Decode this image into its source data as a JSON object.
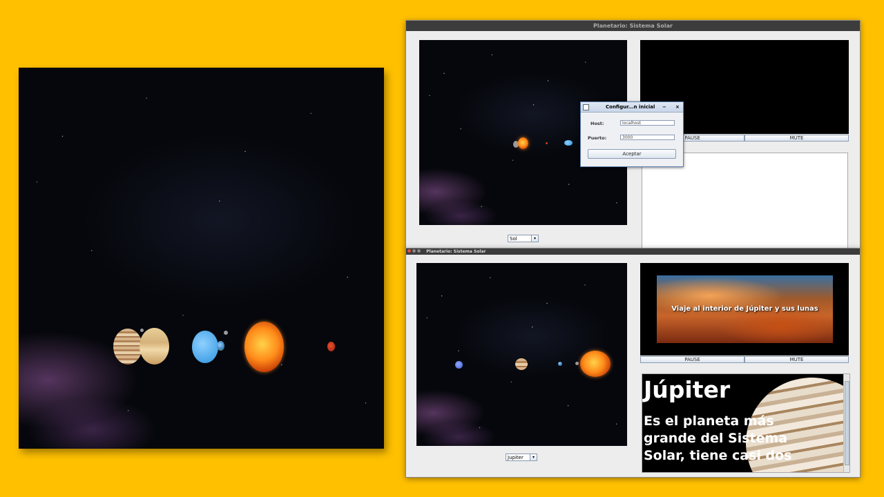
{
  "app": {
    "window_title_top": "Planetario: Sistema Solar",
    "window_title_bottom": "Planetario: Sistema Solar"
  },
  "top_window": {
    "combo_value": "Sol",
    "pause_label": "PAUSE",
    "mute_label": "MUTE"
  },
  "dialog": {
    "title": "Configur...n inicial",
    "minimize_glyph": "−",
    "close_glyph": "×",
    "host_label": "Host:",
    "host_value": "localhost",
    "port_label": "Puerto:",
    "port_value": "3000",
    "accept_label": "Aceptar"
  },
  "bottom_window": {
    "combo_value": "Jupiter",
    "pause_label": "PAUSE",
    "mute_label": "MUTE",
    "video_caption": "Viaje al interior de Júpiter y sus lunas",
    "info_title": "Júpiter",
    "info_text": "Es el planeta más grande del Sistema Solar, tiene casi dos"
  },
  "icons": {
    "combo_arrow": "▾"
  }
}
